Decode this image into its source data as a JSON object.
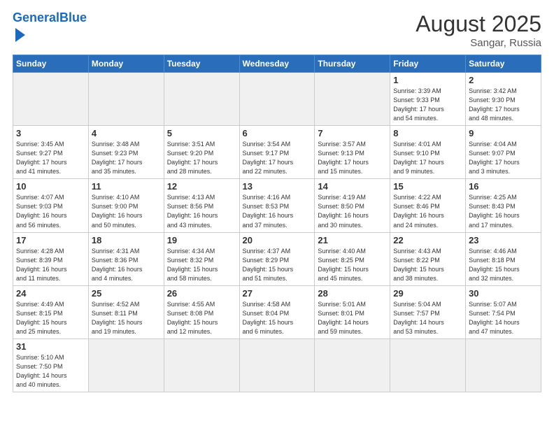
{
  "header": {
    "logo_general": "General",
    "logo_blue": "Blue",
    "month_year": "August 2025",
    "location": "Sangar, Russia"
  },
  "weekdays": [
    "Sunday",
    "Monday",
    "Tuesday",
    "Wednesday",
    "Thursday",
    "Friday",
    "Saturday"
  ],
  "weeks": [
    [
      {
        "day": "",
        "info": "",
        "empty": true
      },
      {
        "day": "",
        "info": "",
        "empty": true
      },
      {
        "day": "",
        "info": "",
        "empty": true
      },
      {
        "day": "",
        "info": "",
        "empty": true
      },
      {
        "day": "",
        "info": "",
        "empty": true
      },
      {
        "day": "1",
        "info": "Sunrise: 3:39 AM\nSunset: 9:33 PM\nDaylight: 17 hours\nand 54 minutes.",
        "empty": false
      },
      {
        "day": "2",
        "info": "Sunrise: 3:42 AM\nSunset: 9:30 PM\nDaylight: 17 hours\nand 48 minutes.",
        "empty": false
      }
    ],
    [
      {
        "day": "3",
        "info": "Sunrise: 3:45 AM\nSunset: 9:27 PM\nDaylight: 17 hours\nand 41 minutes.",
        "empty": false
      },
      {
        "day": "4",
        "info": "Sunrise: 3:48 AM\nSunset: 9:23 PM\nDaylight: 17 hours\nand 35 minutes.",
        "empty": false
      },
      {
        "day": "5",
        "info": "Sunrise: 3:51 AM\nSunset: 9:20 PM\nDaylight: 17 hours\nand 28 minutes.",
        "empty": false
      },
      {
        "day": "6",
        "info": "Sunrise: 3:54 AM\nSunset: 9:17 PM\nDaylight: 17 hours\nand 22 minutes.",
        "empty": false
      },
      {
        "day": "7",
        "info": "Sunrise: 3:57 AM\nSunset: 9:13 PM\nDaylight: 17 hours\nand 15 minutes.",
        "empty": false
      },
      {
        "day": "8",
        "info": "Sunrise: 4:01 AM\nSunset: 9:10 PM\nDaylight: 17 hours\nand 9 minutes.",
        "empty": false
      },
      {
        "day": "9",
        "info": "Sunrise: 4:04 AM\nSunset: 9:07 PM\nDaylight: 17 hours\nand 3 minutes.",
        "empty": false
      }
    ],
    [
      {
        "day": "10",
        "info": "Sunrise: 4:07 AM\nSunset: 9:03 PM\nDaylight: 16 hours\nand 56 minutes.",
        "empty": false
      },
      {
        "day": "11",
        "info": "Sunrise: 4:10 AM\nSunset: 9:00 PM\nDaylight: 16 hours\nand 50 minutes.",
        "empty": false
      },
      {
        "day": "12",
        "info": "Sunrise: 4:13 AM\nSunset: 8:56 PM\nDaylight: 16 hours\nand 43 minutes.",
        "empty": false
      },
      {
        "day": "13",
        "info": "Sunrise: 4:16 AM\nSunset: 8:53 PM\nDaylight: 16 hours\nand 37 minutes.",
        "empty": false
      },
      {
        "day": "14",
        "info": "Sunrise: 4:19 AM\nSunset: 8:50 PM\nDaylight: 16 hours\nand 30 minutes.",
        "empty": false
      },
      {
        "day": "15",
        "info": "Sunrise: 4:22 AM\nSunset: 8:46 PM\nDaylight: 16 hours\nand 24 minutes.",
        "empty": false
      },
      {
        "day": "16",
        "info": "Sunrise: 4:25 AM\nSunset: 8:43 PM\nDaylight: 16 hours\nand 17 minutes.",
        "empty": false
      }
    ],
    [
      {
        "day": "17",
        "info": "Sunrise: 4:28 AM\nSunset: 8:39 PM\nDaylight: 16 hours\nand 11 minutes.",
        "empty": false
      },
      {
        "day": "18",
        "info": "Sunrise: 4:31 AM\nSunset: 8:36 PM\nDaylight: 16 hours\nand 4 minutes.",
        "empty": false
      },
      {
        "day": "19",
        "info": "Sunrise: 4:34 AM\nSunset: 8:32 PM\nDaylight: 15 hours\nand 58 minutes.",
        "empty": false
      },
      {
        "day": "20",
        "info": "Sunrise: 4:37 AM\nSunset: 8:29 PM\nDaylight: 15 hours\nand 51 minutes.",
        "empty": false
      },
      {
        "day": "21",
        "info": "Sunrise: 4:40 AM\nSunset: 8:25 PM\nDaylight: 15 hours\nand 45 minutes.",
        "empty": false
      },
      {
        "day": "22",
        "info": "Sunrise: 4:43 AM\nSunset: 8:22 PM\nDaylight: 15 hours\nand 38 minutes.",
        "empty": false
      },
      {
        "day": "23",
        "info": "Sunrise: 4:46 AM\nSunset: 8:18 PM\nDaylight: 15 hours\nand 32 minutes.",
        "empty": false
      }
    ],
    [
      {
        "day": "24",
        "info": "Sunrise: 4:49 AM\nSunset: 8:15 PM\nDaylight: 15 hours\nand 25 minutes.",
        "empty": false
      },
      {
        "day": "25",
        "info": "Sunrise: 4:52 AM\nSunset: 8:11 PM\nDaylight: 15 hours\nand 19 minutes.",
        "empty": false
      },
      {
        "day": "26",
        "info": "Sunrise: 4:55 AM\nSunset: 8:08 PM\nDaylight: 15 hours\nand 12 minutes.",
        "empty": false
      },
      {
        "day": "27",
        "info": "Sunrise: 4:58 AM\nSunset: 8:04 PM\nDaylight: 15 hours\nand 6 minutes.",
        "empty": false
      },
      {
        "day": "28",
        "info": "Sunrise: 5:01 AM\nSunset: 8:01 PM\nDaylight: 14 hours\nand 59 minutes.",
        "empty": false
      },
      {
        "day": "29",
        "info": "Sunrise: 5:04 AM\nSunset: 7:57 PM\nDaylight: 14 hours\nand 53 minutes.",
        "empty": false
      },
      {
        "day": "30",
        "info": "Sunrise: 5:07 AM\nSunset: 7:54 PM\nDaylight: 14 hours\nand 47 minutes.",
        "empty": false
      }
    ],
    [
      {
        "day": "31",
        "info": "Sunrise: 5:10 AM\nSunset: 7:50 PM\nDaylight: 14 hours\nand 40 minutes.",
        "empty": false
      },
      {
        "day": "",
        "info": "",
        "empty": true
      },
      {
        "day": "",
        "info": "",
        "empty": true
      },
      {
        "day": "",
        "info": "",
        "empty": true
      },
      {
        "day": "",
        "info": "",
        "empty": true
      },
      {
        "day": "",
        "info": "",
        "empty": true
      },
      {
        "day": "",
        "info": "",
        "empty": true
      }
    ]
  ]
}
